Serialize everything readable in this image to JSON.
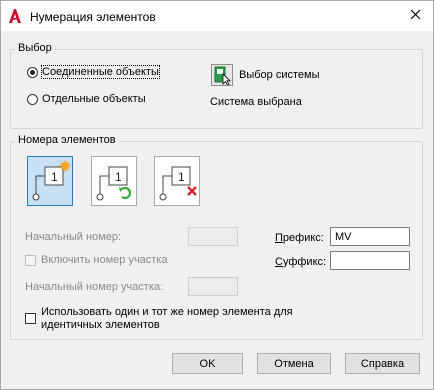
{
  "window": {
    "title": "Нумерация элементов",
    "app_icon": "autocad-a-icon",
    "close_icon": "close-icon"
  },
  "selection_group": {
    "title": "Выбор",
    "radio_connected": {
      "label": "Соединенные объекты",
      "checked": true
    },
    "radio_separate": {
      "label": "Отдельные объекты",
      "checked": false
    },
    "select_system_label": "Выбор системы",
    "select_system_icon": "select-system-icon",
    "status": "Система выбрана"
  },
  "numbers_group": {
    "title": "Номера элементов",
    "tools": [
      {
        "name": "new-number-icon",
        "active": true,
        "digit": "1"
      },
      {
        "name": "renumber-icon",
        "active": false,
        "digit": "1"
      },
      {
        "name": "delete-number-icon",
        "active": false,
        "digit": "1"
      }
    ],
    "start_number_label": "Начальный номер:",
    "start_number_value": "",
    "include_section_label": "Включить номер участка",
    "include_section_checked": false,
    "section_start_label": "Начальный номер участка:",
    "section_start_value": "",
    "prefix_label": "Префикс:",
    "prefix_value": "MV",
    "suffix_label": "Суффикс:",
    "suffix_value": "",
    "same_number_label_line1": "Использовать один и тот же номер элемента для",
    "same_number_label_line2": "идентичных элементов",
    "same_number_checked": false
  },
  "footer": {
    "ok": "OK",
    "cancel": "Отмена",
    "help": "Справка"
  },
  "colors": {
    "accent": "#2a7bc7",
    "active_fill": "#c8e0f4",
    "disabled_text": "#8a8a8a",
    "logo_red": "#c8102e",
    "refresh_green": "#3aa53a",
    "delete_red": "#d9262b",
    "new_star": "#f5a623"
  }
}
